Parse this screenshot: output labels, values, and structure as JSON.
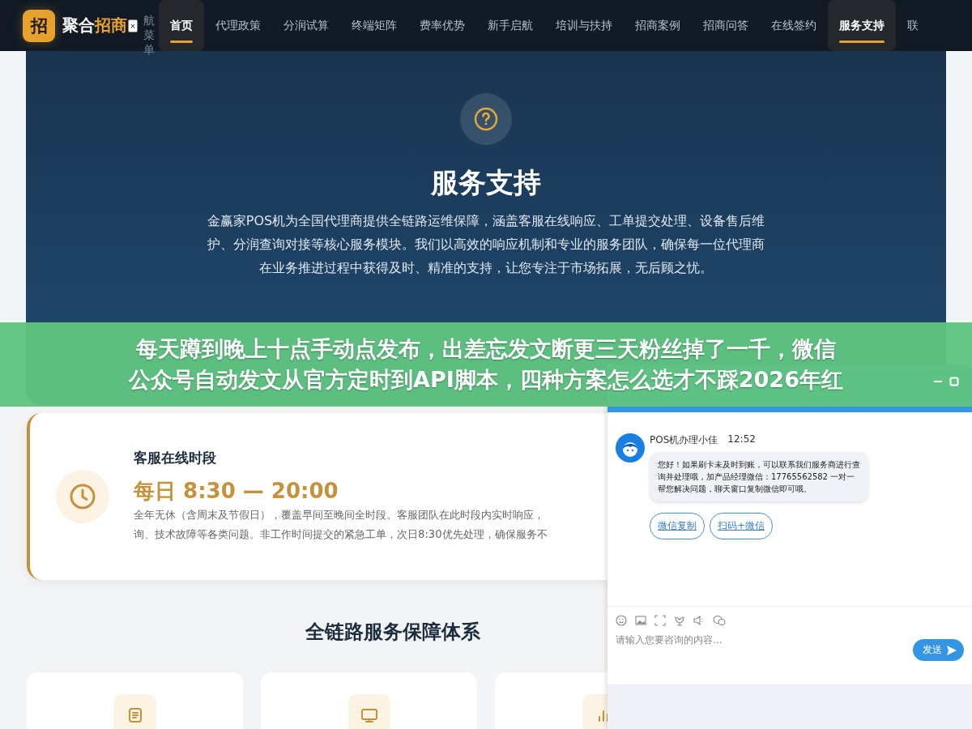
{
  "header": {
    "logo_mark": "招",
    "logo_text_a": "聚合",
    "logo_text_b": "招商",
    "close_label": "×",
    "side_label": "航菜单",
    "nav": [
      {
        "label": "首页",
        "selected": true
      },
      {
        "label": "代理政策",
        "selected": false
      },
      {
        "label": "分润试算",
        "selected": false
      },
      {
        "label": "终端矩阵",
        "selected": false
      },
      {
        "label": "费率优势",
        "selected": false
      },
      {
        "label": "新手启航",
        "selected": false
      },
      {
        "label": "培训与扶持",
        "selected": false
      },
      {
        "label": "招商案例",
        "selected": false
      },
      {
        "label": "招商问答",
        "selected": false
      },
      {
        "label": "在线签约",
        "selected": false
      },
      {
        "label": "服务支持",
        "selected": true
      },
      {
        "label": "联",
        "selected": false
      }
    ]
  },
  "hero": {
    "title": "服务支持",
    "text": "金赢家POS机为全国代理商提供全链路运维保障，涵盖客服在线响应、工单提交处理、设备售后维护、分润查询对接等核心服务模块。我们以高效的响应机制和专业的服务团队，确保每一位代理商在业务推进过程中获得及时、精准的支持，让您专注于市场拓展，无后顾之忧。"
  },
  "banner": {
    "lines": [
      "每天蹲到晚上十点手动点发布，出差忘发文断更三天粉丝掉了一千，微信",
      "公众号自动发文从官方定时到API脚本，四种方案怎么选才不踩2026年红"
    ]
  },
  "hours_card": {
    "title": "客服在线时段",
    "time": "每日 8:30 — 20:00",
    "lines": [
      "全年无休（含周末及节假日），覆盖早间至晚间全时段。客服团队在此时段内实时响应，",
      "询、技术故障等各类问题。非工作时间提交的紧急工单，次日8:30优先处理，确保服务不"
    ]
  },
  "section": {
    "title": "全链路服务保障体系",
    "cards": [
      {
        "kind": "document"
      },
      {
        "kind": "monitor"
      },
      {
        "kind": "chart"
      }
    ]
  },
  "chat": {
    "sender": "POS机办理小佳",
    "time": "12:52",
    "message": "您好！如果刷卡未及时到账，可以联系我们服务商进行查询并处理哦，加产品经理微信：17765562582 一对一帮您解决问题，聊天窗口复制微信即可哦。",
    "actions": [
      "微信复制",
      "扫码+微信"
    ],
    "placeholder": "请输入您要咨询的内容...",
    "send": "发送"
  }
}
